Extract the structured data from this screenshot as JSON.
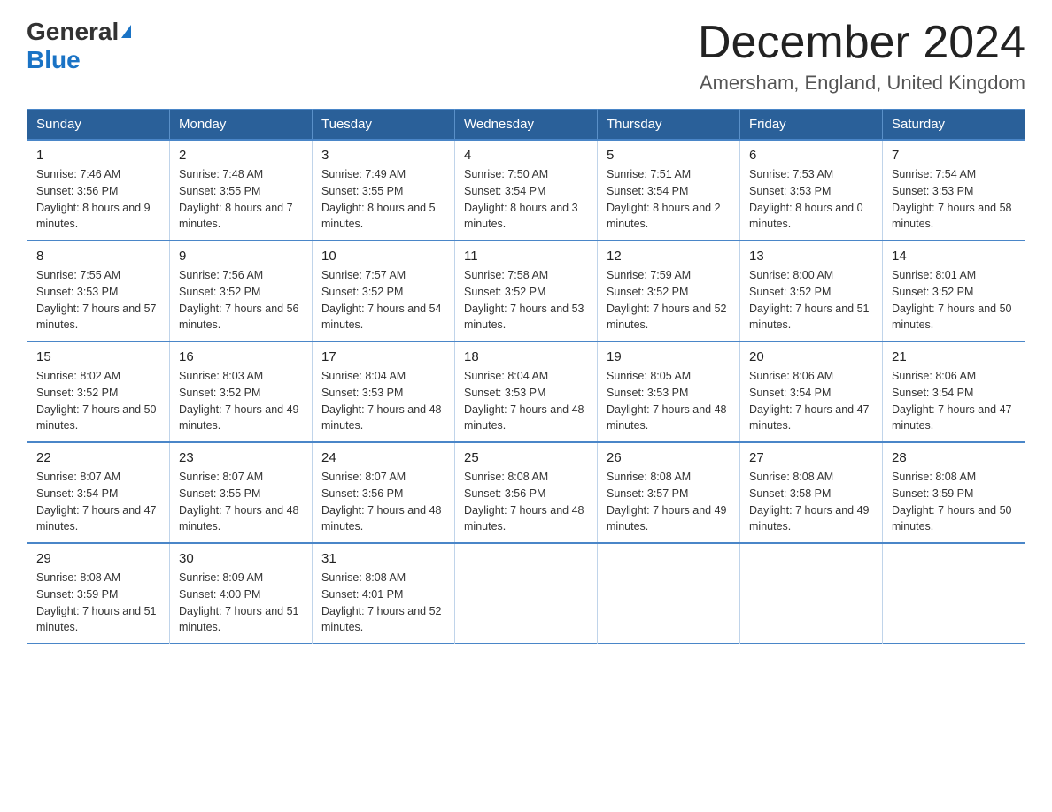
{
  "header": {
    "title": "December 2024",
    "subtitle": "Amersham, England, United Kingdom",
    "logo_general": "General",
    "logo_blue": "Blue"
  },
  "calendar": {
    "days_of_week": [
      "Sunday",
      "Monday",
      "Tuesday",
      "Wednesday",
      "Thursday",
      "Friday",
      "Saturday"
    ],
    "weeks": [
      [
        {
          "day": "1",
          "sunrise": "7:46 AM",
          "sunset": "3:56 PM",
          "daylight": "8 hours and 9 minutes."
        },
        {
          "day": "2",
          "sunrise": "7:48 AM",
          "sunset": "3:55 PM",
          "daylight": "8 hours and 7 minutes."
        },
        {
          "day": "3",
          "sunrise": "7:49 AM",
          "sunset": "3:55 PM",
          "daylight": "8 hours and 5 minutes."
        },
        {
          "day": "4",
          "sunrise": "7:50 AM",
          "sunset": "3:54 PM",
          "daylight": "8 hours and 3 minutes."
        },
        {
          "day": "5",
          "sunrise": "7:51 AM",
          "sunset": "3:54 PM",
          "daylight": "8 hours and 2 minutes."
        },
        {
          "day": "6",
          "sunrise": "7:53 AM",
          "sunset": "3:53 PM",
          "daylight": "8 hours and 0 minutes."
        },
        {
          "day": "7",
          "sunrise": "7:54 AM",
          "sunset": "3:53 PM",
          "daylight": "7 hours and 58 minutes."
        }
      ],
      [
        {
          "day": "8",
          "sunrise": "7:55 AM",
          "sunset": "3:53 PM",
          "daylight": "7 hours and 57 minutes."
        },
        {
          "day": "9",
          "sunrise": "7:56 AM",
          "sunset": "3:52 PM",
          "daylight": "7 hours and 56 minutes."
        },
        {
          "day": "10",
          "sunrise": "7:57 AM",
          "sunset": "3:52 PM",
          "daylight": "7 hours and 54 minutes."
        },
        {
          "day": "11",
          "sunrise": "7:58 AM",
          "sunset": "3:52 PM",
          "daylight": "7 hours and 53 minutes."
        },
        {
          "day": "12",
          "sunrise": "7:59 AM",
          "sunset": "3:52 PM",
          "daylight": "7 hours and 52 minutes."
        },
        {
          "day": "13",
          "sunrise": "8:00 AM",
          "sunset": "3:52 PM",
          "daylight": "7 hours and 51 minutes."
        },
        {
          "day": "14",
          "sunrise": "8:01 AM",
          "sunset": "3:52 PM",
          "daylight": "7 hours and 50 minutes."
        }
      ],
      [
        {
          "day": "15",
          "sunrise": "8:02 AM",
          "sunset": "3:52 PM",
          "daylight": "7 hours and 50 minutes."
        },
        {
          "day": "16",
          "sunrise": "8:03 AM",
          "sunset": "3:52 PM",
          "daylight": "7 hours and 49 minutes."
        },
        {
          "day": "17",
          "sunrise": "8:04 AM",
          "sunset": "3:53 PM",
          "daylight": "7 hours and 48 minutes."
        },
        {
          "day": "18",
          "sunrise": "8:04 AM",
          "sunset": "3:53 PM",
          "daylight": "7 hours and 48 minutes."
        },
        {
          "day": "19",
          "sunrise": "8:05 AM",
          "sunset": "3:53 PM",
          "daylight": "7 hours and 48 minutes."
        },
        {
          "day": "20",
          "sunrise": "8:06 AM",
          "sunset": "3:54 PM",
          "daylight": "7 hours and 47 minutes."
        },
        {
          "day": "21",
          "sunrise": "8:06 AM",
          "sunset": "3:54 PM",
          "daylight": "7 hours and 47 minutes."
        }
      ],
      [
        {
          "day": "22",
          "sunrise": "8:07 AM",
          "sunset": "3:54 PM",
          "daylight": "7 hours and 47 minutes."
        },
        {
          "day": "23",
          "sunrise": "8:07 AM",
          "sunset": "3:55 PM",
          "daylight": "7 hours and 48 minutes."
        },
        {
          "day": "24",
          "sunrise": "8:07 AM",
          "sunset": "3:56 PM",
          "daylight": "7 hours and 48 minutes."
        },
        {
          "day": "25",
          "sunrise": "8:08 AM",
          "sunset": "3:56 PM",
          "daylight": "7 hours and 48 minutes."
        },
        {
          "day": "26",
          "sunrise": "8:08 AM",
          "sunset": "3:57 PM",
          "daylight": "7 hours and 49 minutes."
        },
        {
          "day": "27",
          "sunrise": "8:08 AM",
          "sunset": "3:58 PM",
          "daylight": "7 hours and 49 minutes."
        },
        {
          "day": "28",
          "sunrise": "8:08 AM",
          "sunset": "3:59 PM",
          "daylight": "7 hours and 50 minutes."
        }
      ],
      [
        {
          "day": "29",
          "sunrise": "8:08 AM",
          "sunset": "3:59 PM",
          "daylight": "7 hours and 51 minutes."
        },
        {
          "day": "30",
          "sunrise": "8:09 AM",
          "sunset": "4:00 PM",
          "daylight": "7 hours and 51 minutes."
        },
        {
          "day": "31",
          "sunrise": "8:08 AM",
          "sunset": "4:01 PM",
          "daylight": "7 hours and 52 minutes."
        },
        null,
        null,
        null,
        null
      ]
    ]
  }
}
